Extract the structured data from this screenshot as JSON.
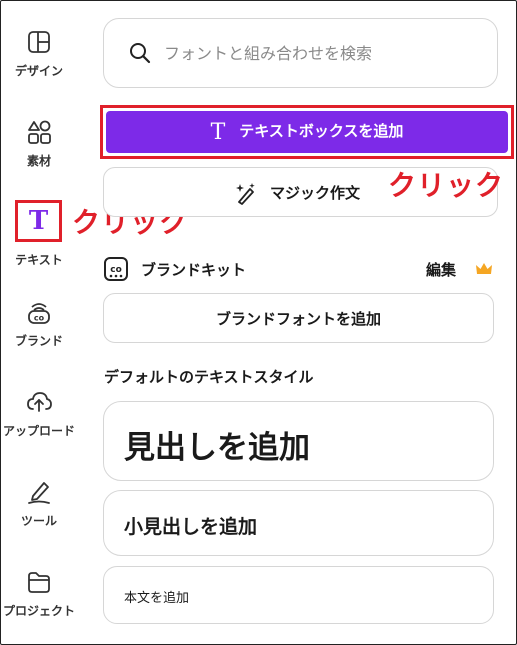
{
  "sidebar": {
    "items": [
      {
        "label": "デザイン",
        "icon": "layout-icon"
      },
      {
        "label": "素材",
        "icon": "elements-icon"
      },
      {
        "label": "テキスト",
        "icon": "text-icon"
      },
      {
        "label": "ブランド",
        "icon": "brand-icon"
      },
      {
        "label": "アップロード",
        "icon": "cloud-upload-icon"
      },
      {
        "label": "ツール",
        "icon": "pen-tool-icon"
      },
      {
        "label": "プロジェクト",
        "icon": "folder-icon"
      }
    ],
    "active_text_glyph": "T"
  },
  "annotations": {
    "click_left": "クリック",
    "click_right": "クリック",
    "color": "#e0202a"
  },
  "search": {
    "placeholder": "フォントと組み合わせを検索"
  },
  "panel": {
    "add_textbox_label": "テキストボックスを追加",
    "add_textbox_glyph": "T",
    "magic_write_label": "マジック作文",
    "brand_kit": {
      "title": "ブランドキット",
      "edit_label": "編集"
    },
    "add_brand_font_label": "ブランドフォントを追加",
    "default_styles_title": "デフォルトのテキストスタイル",
    "add_heading_label": "見出しを追加",
    "add_subheading_label": "小見出しを追加",
    "add_body_label": "本文を追加"
  },
  "colors": {
    "accent": "#7d2ae8",
    "highlight": "#e0202a",
    "crown": "#f5a623"
  }
}
